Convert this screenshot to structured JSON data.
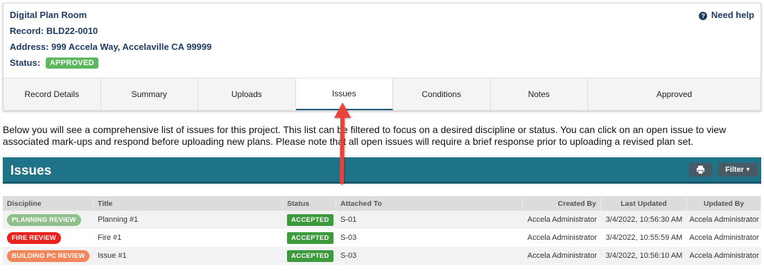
{
  "record": {
    "room_title": "Digital Plan Room",
    "record_line": "Record: BLD22-0010",
    "address_line": "Address: 999 Accela Way, Accelaville CA 99999",
    "status_label": "Status:",
    "status_value": "APPROVED",
    "status_color": "#5cb85c",
    "help_label": "Need help",
    "help_icon": "question-circle-icon"
  },
  "tabs": [
    {
      "label": "Record Details"
    },
    {
      "label": "Summary"
    },
    {
      "label": "Uploads"
    },
    {
      "label": "Issues",
      "active": true
    },
    {
      "label": "Conditions"
    },
    {
      "label": "Notes"
    },
    {
      "label": "Approved"
    }
  ],
  "intro_text": "Below you will see a comprehensive list of issues for this project. This list can be filtered to focus on a desired discipline or status. You can click on an open issue to view associated mark-ups and respond before uploading new plans. Please note that all open issues will require a brief response prior to uploading a revised plan set.",
  "issues_panel": {
    "title": "Issues",
    "print_icon": "print-icon",
    "filter_label": "Filter",
    "bar_color": "#1f7389"
  },
  "table": {
    "columns": [
      "Discipline",
      "Title",
      "Status",
      "Attached To",
      "Created By",
      "Last Updated",
      "Updated By"
    ],
    "rows": [
      {
        "discipline": "PLANNING REVIEW",
        "discipline_color": "#8fbf8a",
        "title": "Planning #1",
        "status": "ACCEPTED",
        "attached_to": "S-01",
        "created_by": "Accela Administrator",
        "last_updated": "3/4/2022, 10:56:30 AM",
        "updated_by": "Accela Administrator"
      },
      {
        "discipline": "FIRE REVIEW",
        "discipline_color": "#e8231c",
        "title": "Fire #1",
        "status": "ACCEPTED",
        "attached_to": "S-03",
        "created_by": "Accela Administrator",
        "last_updated": "3/4/2022, 10:55:59 AM",
        "updated_by": "Accela Administrator"
      },
      {
        "discipline": "BUILDING PC REVIEW",
        "discipline_color": "#f0875a",
        "title": "Issue #1",
        "status": "ACCEPTED",
        "attached_to": "S-03",
        "created_by": "Accela Administrator",
        "last_updated": "3/4/2022, 10:56:10 AM",
        "updated_by": "Accela Administrator"
      }
    ]
  },
  "annotation_color": "#e8433a"
}
